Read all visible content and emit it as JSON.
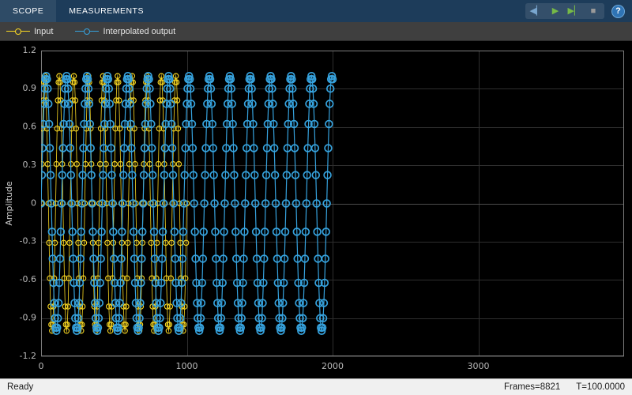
{
  "toolstrip": {
    "tabs": [
      {
        "label": "SCOPE"
      },
      {
        "label": "MEASUREMENTS"
      }
    ],
    "buttons": [
      {
        "id": "step-back",
        "glyph": "◀▏",
        "color": "#7aa7cf"
      },
      {
        "id": "run",
        "glyph": "▶",
        "color": "#76b947"
      },
      {
        "id": "step-forward",
        "glyph": "▶▏",
        "color": "#76b947"
      },
      {
        "id": "stop",
        "glyph": "■",
        "color": "#9a9a9a"
      }
    ],
    "help_label": "?"
  },
  "legend": {
    "items": [
      {
        "label": "Input",
        "color": "#f9d823"
      },
      {
        "label": "Interpolated output",
        "color": "#36a2dd"
      }
    ]
  },
  "chart_data": {
    "type": "line",
    "title": "",
    "xlabel": "",
    "ylabel": "Amplitude",
    "xlim": [
      0,
      4000
    ],
    "ylim": [
      -1.2,
      1.2
    ],
    "xticks": [
      0,
      1000,
      2000,
      3000
    ],
    "xtick_labels": [
      "0",
      "1000",
      "2000",
      "3000"
    ],
    "yticks": [
      -1.2,
      -0.9,
      -0.6,
      -0.3,
      0,
      0.3,
      0.6,
      0.9,
      1.2
    ],
    "ytick_labels": [
      "-1.2",
      "-0.9",
      "-0.6",
      "-0.3",
      "0",
      "0.3",
      "0.6",
      "0.9",
      "1.2"
    ],
    "grid": true,
    "legend_position": "top",
    "background_color": "#000000",
    "grid_color": "#2e2e2e",
    "zero_line_color": "#4d4d4d",
    "axis_color": "#7d7d7d",
    "tick_label_color": "#b9b9b9",
    "axis_label_color": "#cfcfcf",
    "series": [
      {
        "name": "Input",
        "color": "#f9d823",
        "marker": "circle",
        "waveform": "sine",
        "amplitude": 1.0,
        "period_samples": 100,
        "x_start": 0,
        "x_end": 1000,
        "sample_step": 5,
        "marker_radius": 3.2,
        "marker_stroke": 1.1,
        "line_width": 0.8
      },
      {
        "name": "Interpolated output",
        "color": "#36a2dd",
        "marker": "circle",
        "waveform": "sine",
        "amplitude": 1.0,
        "period_samples": 140,
        "x_start": 0,
        "x_end": 2000,
        "sample_step": 5,
        "marker_radius": 4.4,
        "marker_stroke": 1.7,
        "line_width": 1.2
      }
    ]
  },
  "status_bar": {
    "ready": "Ready",
    "frames": "Frames=8821",
    "time": "T=100.0000"
  }
}
